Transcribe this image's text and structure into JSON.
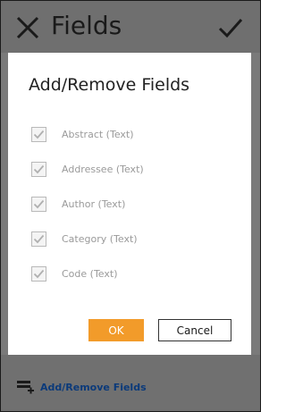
{
  "header": {
    "title": "Fields"
  },
  "dialog": {
    "title": "Add/Remove Fields",
    "fields": [
      {
        "label": "Abstract (Text)",
        "checked": true
      },
      {
        "label": "Addressee (Text)",
        "checked": true
      },
      {
        "label": "Author (Text)",
        "checked": true
      },
      {
        "label": "Category (Text)",
        "checked": true
      },
      {
        "label": "Code (Text)",
        "checked": true
      }
    ],
    "ok_label": "OK",
    "cancel_label": "Cancel"
  },
  "footer": {
    "action_label": "Add/Remove Fields"
  },
  "colors": {
    "accent": "#f29b2a",
    "link": "#0b3a7a",
    "dim_background": "#7a7a7a"
  },
  "icons": {
    "close": "close-icon",
    "confirm": "checkmark-icon",
    "add_remove": "add-remove-fields-icon",
    "checkbox": "checkbox-icon"
  }
}
